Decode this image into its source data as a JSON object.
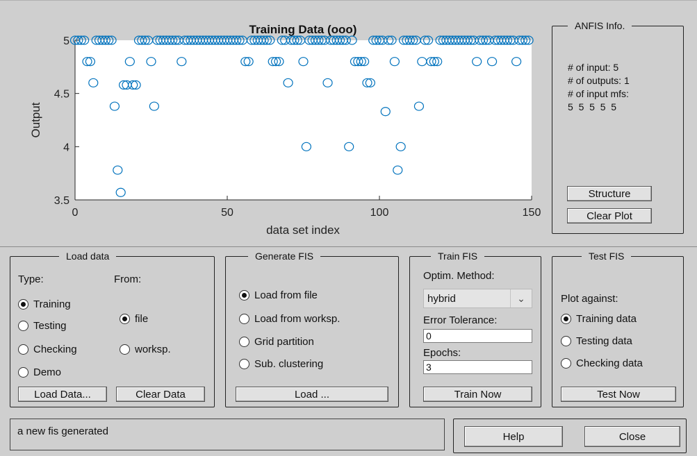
{
  "plot": {
    "title": "Training Data (ooo)",
    "xlabel": "data set index",
    "ylabel": "Output",
    "marker_color": "#0072bd"
  },
  "chart_data": {
    "type": "scatter",
    "title": "Training Data (ooo)",
    "xlabel": "data set index",
    "ylabel": "Output",
    "xlim": [
      0,
      150
    ],
    "ylim": [
      3.5,
      5
    ],
    "xticks": [
      0,
      50,
      100,
      150
    ],
    "yticks": [
      3.5,
      4,
      4.5,
      5
    ],
    "xtick_labels": [
      "0",
      "50",
      "100",
      "150"
    ],
    "ytick_labels": [
      "3.5",
      "4",
      "4.5",
      "5"
    ],
    "marker": "o",
    "series": [
      {
        "points": [
          [
            0,
            5
          ],
          [
            1,
            5
          ],
          [
            2,
            5
          ],
          [
            3,
            5
          ],
          [
            4,
            4.8
          ],
          [
            5,
            4.8
          ],
          [
            6,
            4.6
          ],
          [
            7,
            5
          ],
          [
            8,
            5
          ],
          [
            9,
            5
          ],
          [
            10,
            5
          ],
          [
            11,
            5
          ],
          [
            12,
            5
          ],
          [
            13,
            4.38
          ],
          [
            14,
            3.78
          ],
          [
            15,
            3.57
          ],
          [
            16,
            4.58
          ],
          [
            17,
            4.58
          ],
          [
            18,
            4.8
          ],
          [
            19,
            4.58
          ],
          [
            20,
            4.58
          ],
          [
            21,
            5
          ],
          [
            22,
            5
          ],
          [
            23,
            5
          ],
          [
            24,
            5
          ],
          [
            25,
            4.8
          ],
          [
            26,
            4.38
          ],
          [
            27,
            5
          ],
          [
            28,
            5
          ],
          [
            29,
            5
          ],
          [
            30,
            5
          ],
          [
            31,
            5
          ],
          [
            32,
            5
          ],
          [
            33,
            5
          ],
          [
            34,
            5
          ],
          [
            35,
            4.8
          ],
          [
            36,
            5
          ],
          [
            37,
            5
          ],
          [
            38,
            5
          ],
          [
            39,
            5
          ],
          [
            40,
            5
          ],
          [
            41,
            5
          ],
          [
            42,
            5
          ],
          [
            43,
            5
          ],
          [
            44,
            5
          ],
          [
            45,
            5
          ],
          [
            46,
            5
          ],
          [
            47,
            5
          ],
          [
            48,
            5
          ],
          [
            49,
            5
          ],
          [
            50,
            5
          ],
          [
            51,
            5
          ],
          [
            52,
            5
          ],
          [
            53,
            5
          ],
          [
            54,
            5
          ],
          [
            55,
            5
          ],
          [
            56,
            4.8
          ],
          [
            57,
            4.8
          ],
          [
            58,
            5
          ],
          [
            59,
            5
          ],
          [
            60,
            5
          ],
          [
            61,
            5
          ],
          [
            62,
            5
          ],
          [
            63,
            5
          ],
          [
            64,
            5
          ],
          [
            65,
            4.8
          ],
          [
            66,
            4.8
          ],
          [
            67,
            4.8
          ],
          [
            68,
            5
          ],
          [
            69,
            5
          ],
          [
            70,
            4.6
          ],
          [
            71,
            5
          ],
          [
            72,
            5
          ],
          [
            73,
            5
          ],
          [
            74,
            5
          ],
          [
            75,
            4.8
          ],
          [
            76,
            4.0
          ],
          [
            77,
            5
          ],
          [
            78,
            5
          ],
          [
            79,
            5
          ],
          [
            80,
            5
          ],
          [
            81,
            5
          ],
          [
            82,
            5
          ],
          [
            83,
            4.6
          ],
          [
            84,
            5
          ],
          [
            85,
            5
          ],
          [
            86,
            5
          ],
          [
            87,
            5
          ],
          [
            88,
            5
          ],
          [
            89,
            5
          ],
          [
            90,
            4.0
          ],
          [
            91,
            5
          ],
          [
            92,
            4.8
          ],
          [
            93,
            4.8
          ],
          [
            94,
            4.8
          ],
          [
            95,
            4.8
          ],
          [
            96,
            4.6
          ],
          [
            97,
            4.6
          ],
          [
            98,
            5
          ],
          [
            99,
            5
          ],
          [
            100,
            5
          ],
          [
            101,
            5
          ],
          [
            102,
            4.33
          ],
          [
            103,
            5
          ],
          [
            104,
            5
          ],
          [
            105,
            4.8
          ],
          [
            106,
            3.78
          ],
          [
            107,
            4.0
          ],
          [
            108,
            5
          ],
          [
            109,
            5
          ],
          [
            110,
            5
          ],
          [
            111,
            5
          ],
          [
            112,
            5
          ],
          [
            113,
            4.38
          ],
          [
            114,
            4.8
          ],
          [
            115,
            5
          ],
          [
            116,
            5
          ],
          [
            117,
            4.8
          ],
          [
            118,
            4.8
          ],
          [
            119,
            4.8
          ],
          [
            120,
            5
          ],
          [
            121,
            5
          ],
          [
            122,
            5
          ],
          [
            123,
            5
          ],
          [
            124,
            5
          ],
          [
            125,
            5
          ],
          [
            126,
            5
          ],
          [
            127,
            5
          ],
          [
            128,
            5
          ],
          [
            129,
            5
          ],
          [
            130,
            5
          ],
          [
            131,
            5
          ],
          [
            132,
            4.8
          ],
          [
            133,
            5
          ],
          [
            134,
            5
          ],
          [
            135,
            5
          ],
          [
            136,
            5
          ],
          [
            137,
            4.8
          ],
          [
            138,
            5
          ],
          [
            139,
            5
          ],
          [
            140,
            5
          ],
          [
            141,
            5
          ],
          [
            142,
            5
          ],
          [
            143,
            5
          ],
          [
            144,
            5
          ],
          [
            145,
            4.8
          ],
          [
            146,
            5
          ],
          [
            147,
            5
          ],
          [
            148,
            5
          ],
          [
            149,
            5
          ]
        ]
      }
    ]
  },
  "anfis_info": {
    "title": "ANFIS Info.",
    "lines": [
      "# of input: 5",
      "# of outputs: 1",
      "# of input mfs:",
      "5  5  5  5  5"
    ],
    "structure_button": "Structure",
    "clear_plot_button": "Clear Plot"
  },
  "load_data": {
    "title": "Load data",
    "type_label": "Type:",
    "from_label": "From:",
    "types": [
      "Training",
      "Testing",
      "Checking",
      "Demo"
    ],
    "types_selected": "Training",
    "sources": [
      "file",
      "worksp."
    ],
    "source_selected": "file",
    "load_button": "Load Data...",
    "clear_button": "Clear Data"
  },
  "generate_fis": {
    "title": "Generate FIS",
    "options": [
      "Load from file",
      "Load from worksp.",
      "Grid partition",
      "Sub. clustering"
    ],
    "selected": "Load from file",
    "load_button": "Load ..."
  },
  "train_fis": {
    "title": "Train FIS",
    "method_label": "Optim. Method:",
    "method_value": "hybrid",
    "error_label": "Error Tolerance:",
    "error_value": "0",
    "epochs_label": "Epochs:",
    "epochs_value": "3",
    "train_button": "Train Now"
  },
  "test_fis": {
    "title": "Test FIS",
    "plot_against_label": "Plot against:",
    "options": [
      "Training data",
      "Testing data",
      "Checking data"
    ],
    "selected": "Training data",
    "test_button": "Test Now"
  },
  "status": {
    "message": "a new fis generated"
  },
  "footer": {
    "help_button": "Help",
    "close_button": "Close"
  }
}
